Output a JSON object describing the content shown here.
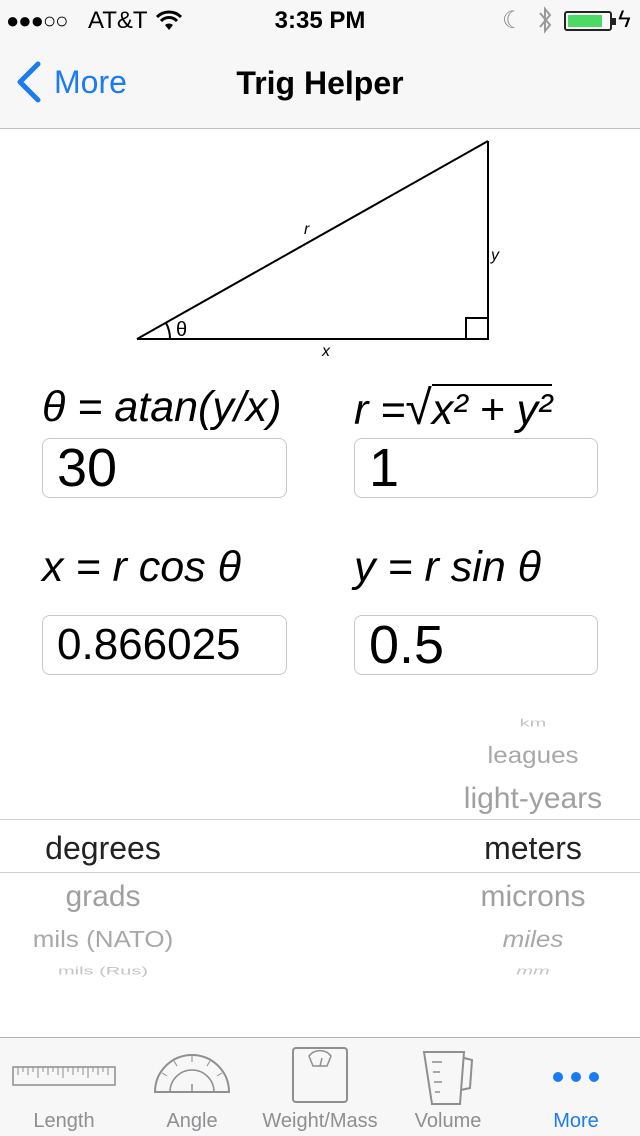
{
  "status_bar": {
    "signal": "●●●○○",
    "carrier": "AT&T",
    "time": "3:35 PM",
    "battery_color": "#4cd964"
  },
  "nav": {
    "back_label": "More",
    "title": "Trig Helper"
  },
  "diagram": {
    "hyp_label": "r",
    "opp_label": "y",
    "adj_label": "x",
    "angle_label": "θ"
  },
  "formulas": {
    "theta": {
      "label": "θ = atan(y/x)",
      "value": "30"
    },
    "r": {
      "label_prefix": "r =",
      "label_radical": "√",
      "label_body": "x² + y²",
      "value": "1"
    },
    "x": {
      "label": "x = r cos θ",
      "value": "0.866025"
    },
    "y": {
      "label": "y = r sin θ",
      "value": "0.5"
    }
  },
  "picker": {
    "angle_units": {
      "selected": "degrees",
      "below": [
        "grads",
        "mils (NATO)",
        "mils (Rus)"
      ]
    },
    "length_units": {
      "above": [
        "km",
        "leagues",
        "light-years"
      ],
      "selected": "meters",
      "below": [
        "microns",
        "miles",
        "mm"
      ]
    }
  },
  "tab_bar": {
    "tabs": [
      {
        "label": "Length",
        "icon": "ruler-icon"
      },
      {
        "label": "Angle",
        "icon": "protractor-icon"
      },
      {
        "label": "Weight/Mass",
        "icon": "scale-icon"
      },
      {
        "label": "Volume",
        "icon": "measuring-cup-icon"
      },
      {
        "label": "More",
        "icon": "more-dots-icon",
        "active": true
      }
    ],
    "active_color": "#1b7cf2"
  }
}
